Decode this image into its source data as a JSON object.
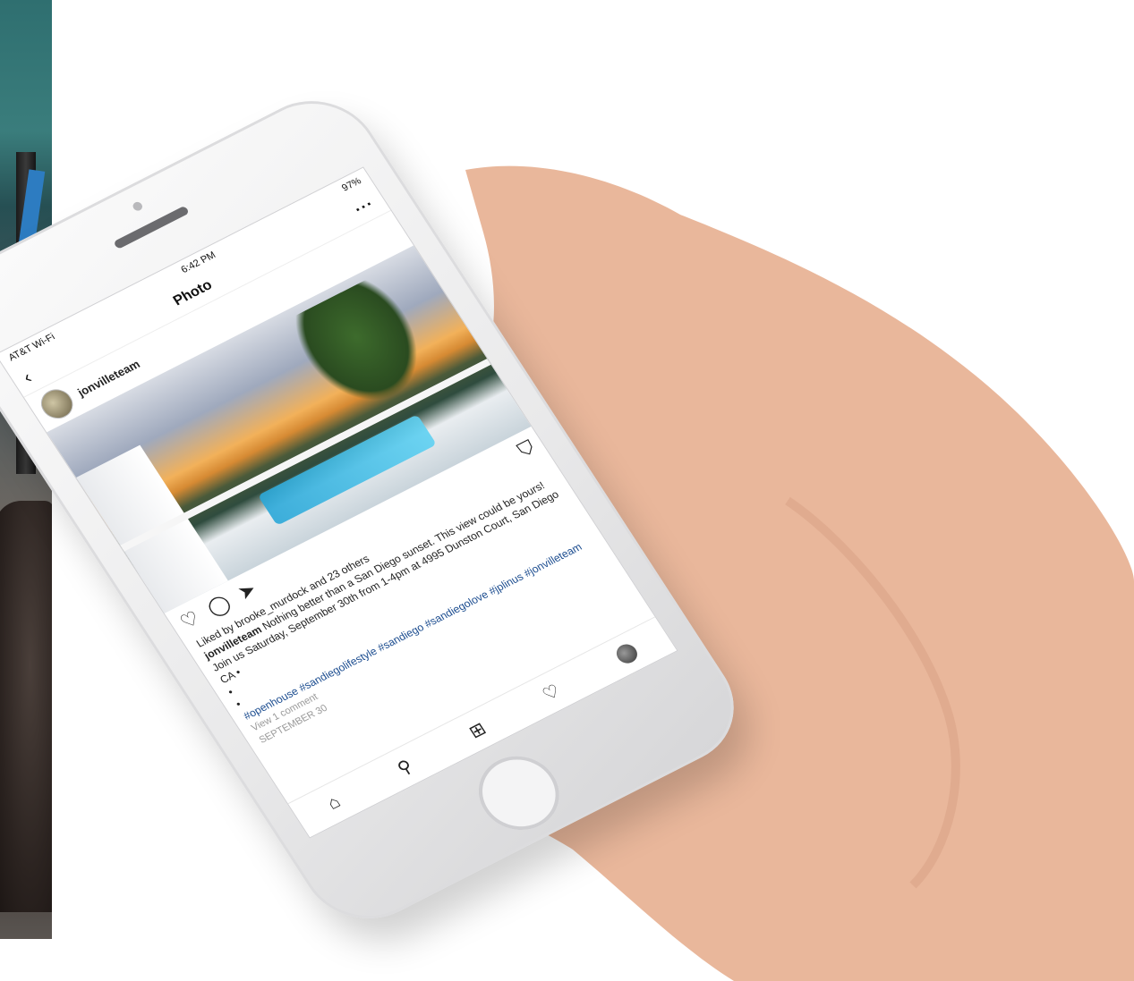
{
  "status_bar": {
    "carrier": "AT&T Wi-Fi",
    "time": "6:42 PM",
    "battery": "97%"
  },
  "nav": {
    "title": "Photo",
    "back_icon": "chevron-left-icon",
    "more_icon": "more-horizontal-icon"
  },
  "post": {
    "username": "jonvilleteam",
    "likes_text": "Liked by brooke_murdock and 23 others",
    "caption_user": "jonvilleteam",
    "caption_text": "Nothing better than a San Diego sunset. This view could be yours! Join us Saturday, September 30th from 1-4pm at 4995 Dunston Court, San Diego CA •",
    "bullet1": "•",
    "bullet2": "•",
    "hashtags": "#openhouse #sandiegolifestyle #sandiego #sandiegolove #jplinus #jonvilleteam",
    "view_comments": "View 1 comment",
    "timestamp": "SEPTEMBER 30"
  },
  "icons": {
    "like": "heart-icon",
    "comment": "comment-icon",
    "share": "send-icon",
    "save": "bookmark-icon",
    "home": "home-icon",
    "search": "search-icon",
    "add": "add-post-icon",
    "activity": "heart-icon",
    "profile": "avatar-icon"
  }
}
